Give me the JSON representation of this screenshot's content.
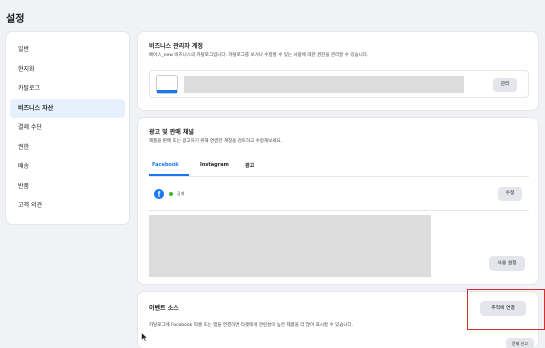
{
  "page": {
    "title": "설정"
  },
  "sidebar": {
    "items": [
      {
        "label": "일반",
        "active": false
      },
      {
        "label": "현지화",
        "active": false
      },
      {
        "label": "카탈로그",
        "active": false
      },
      {
        "label": "비즈니스 자산",
        "active": true
      },
      {
        "label": "결제 수단",
        "active": false
      },
      {
        "label": "권한",
        "active": false
      },
      {
        "label": "배송",
        "active": false
      },
      {
        "label": "반품",
        "active": false
      },
      {
        "label": "고객 의견",
        "active": false
      }
    ]
  },
  "business_account": {
    "title": "비즈니스 관리자 계정",
    "description": "베이스_new 비즈니스의 카탈로그입니다. 카탈로그를 보거나 수정할 수 있는 사람에 대한 권한을 관리할 수 있습니다.",
    "manage_label": "관리"
  },
  "sales_channels": {
    "title": "광고 및 판매 채널",
    "description": "제품을 판매 또는 광고하기 위해 연결한 계정을 검토하고 수정해보세요.",
    "tabs": [
      "Facebook",
      "Instagram",
      "광고"
    ],
    "active_tab": "Facebook",
    "status_label": "공개",
    "edit_label": "수정",
    "usage_settings_label": "사용 설정",
    "accent_color": "#1877f2",
    "status_color": "#42b72a"
  },
  "event_source": {
    "title": "이벤트 소스",
    "description": "카탈로그에 Facebook 픽셀 또는 앱을 연결하면 타겟에게 관련성이 높은 제품을 더 많이 표시할 수 있습니다.",
    "connect_label": "추적에 연결",
    "bottom_button_label": "문제 신고"
  },
  "highlight_color": "#d32f2f"
}
